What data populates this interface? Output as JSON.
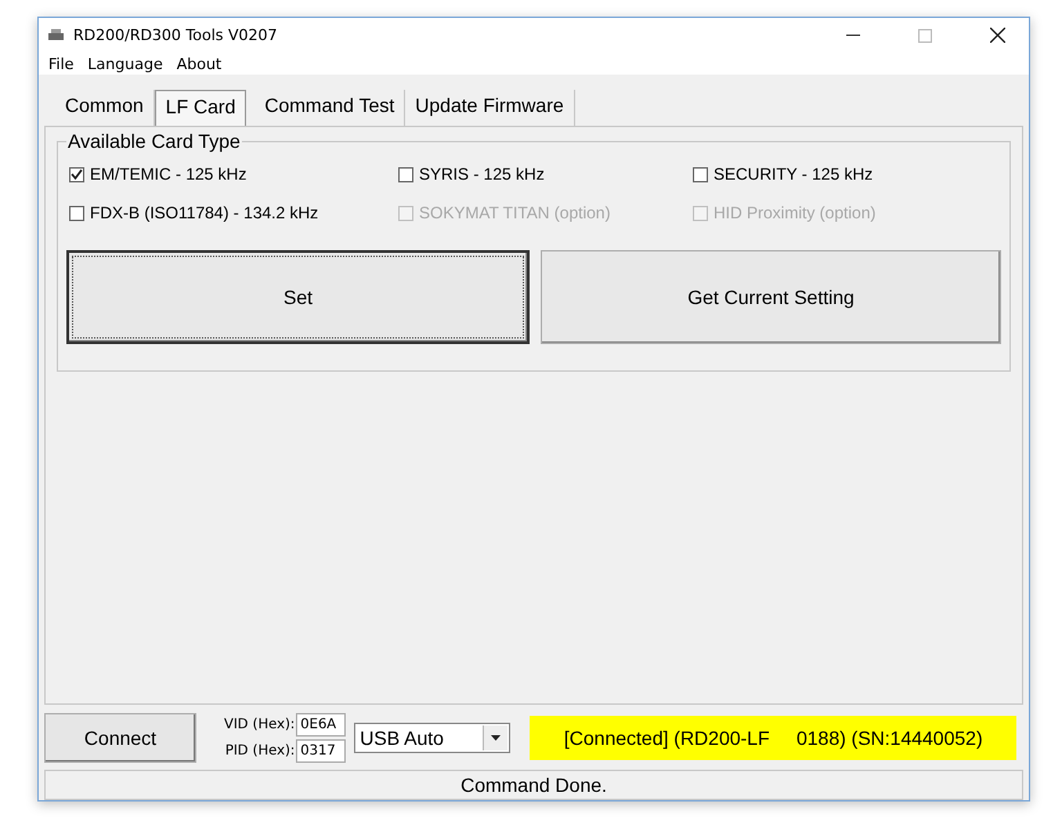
{
  "window": {
    "title": "RD200/RD300 Tools V0207"
  },
  "menu": [
    "File",
    "Language",
    "About"
  ],
  "tabs": [
    {
      "label": "Common",
      "selected": false
    },
    {
      "label": "LF Card",
      "selected": true
    },
    {
      "label": "Command Test",
      "selected": false
    },
    {
      "label": "Update Firmware",
      "selected": false
    }
  ],
  "card_type_group": {
    "title": "Available Card Type",
    "options": [
      {
        "label": "EM/TEMIC - 125 kHz",
        "checked": true,
        "disabled": false
      },
      {
        "label": "SYRIS - 125 kHz",
        "checked": false,
        "disabled": false
      },
      {
        "label": "SECURITY - 125 kHz",
        "checked": false,
        "disabled": false
      },
      {
        "label": "FDX-B (ISO11784) - 134.2 kHz",
        "checked": false,
        "disabled": false
      },
      {
        "label": "SOKYMAT TITAN (option)",
        "checked": false,
        "disabled": true
      },
      {
        "label": "HID Proximity (option)",
        "checked": false,
        "disabled": true
      }
    ],
    "buttons": [
      {
        "label": "Set",
        "default": true
      },
      {
        "label": "Get Current Setting",
        "default": false
      }
    ]
  },
  "connection": {
    "connect_button": "Connect",
    "vid": {
      "label": "VID (Hex):",
      "value": "0E6A"
    },
    "pid": {
      "label": "PID (Hex):",
      "value": "0317"
    },
    "port": "USB Auto",
    "status": "[Connected] (RD200-LF     0188) (SN:14440052)"
  },
  "status_bar": "Command Done."
}
